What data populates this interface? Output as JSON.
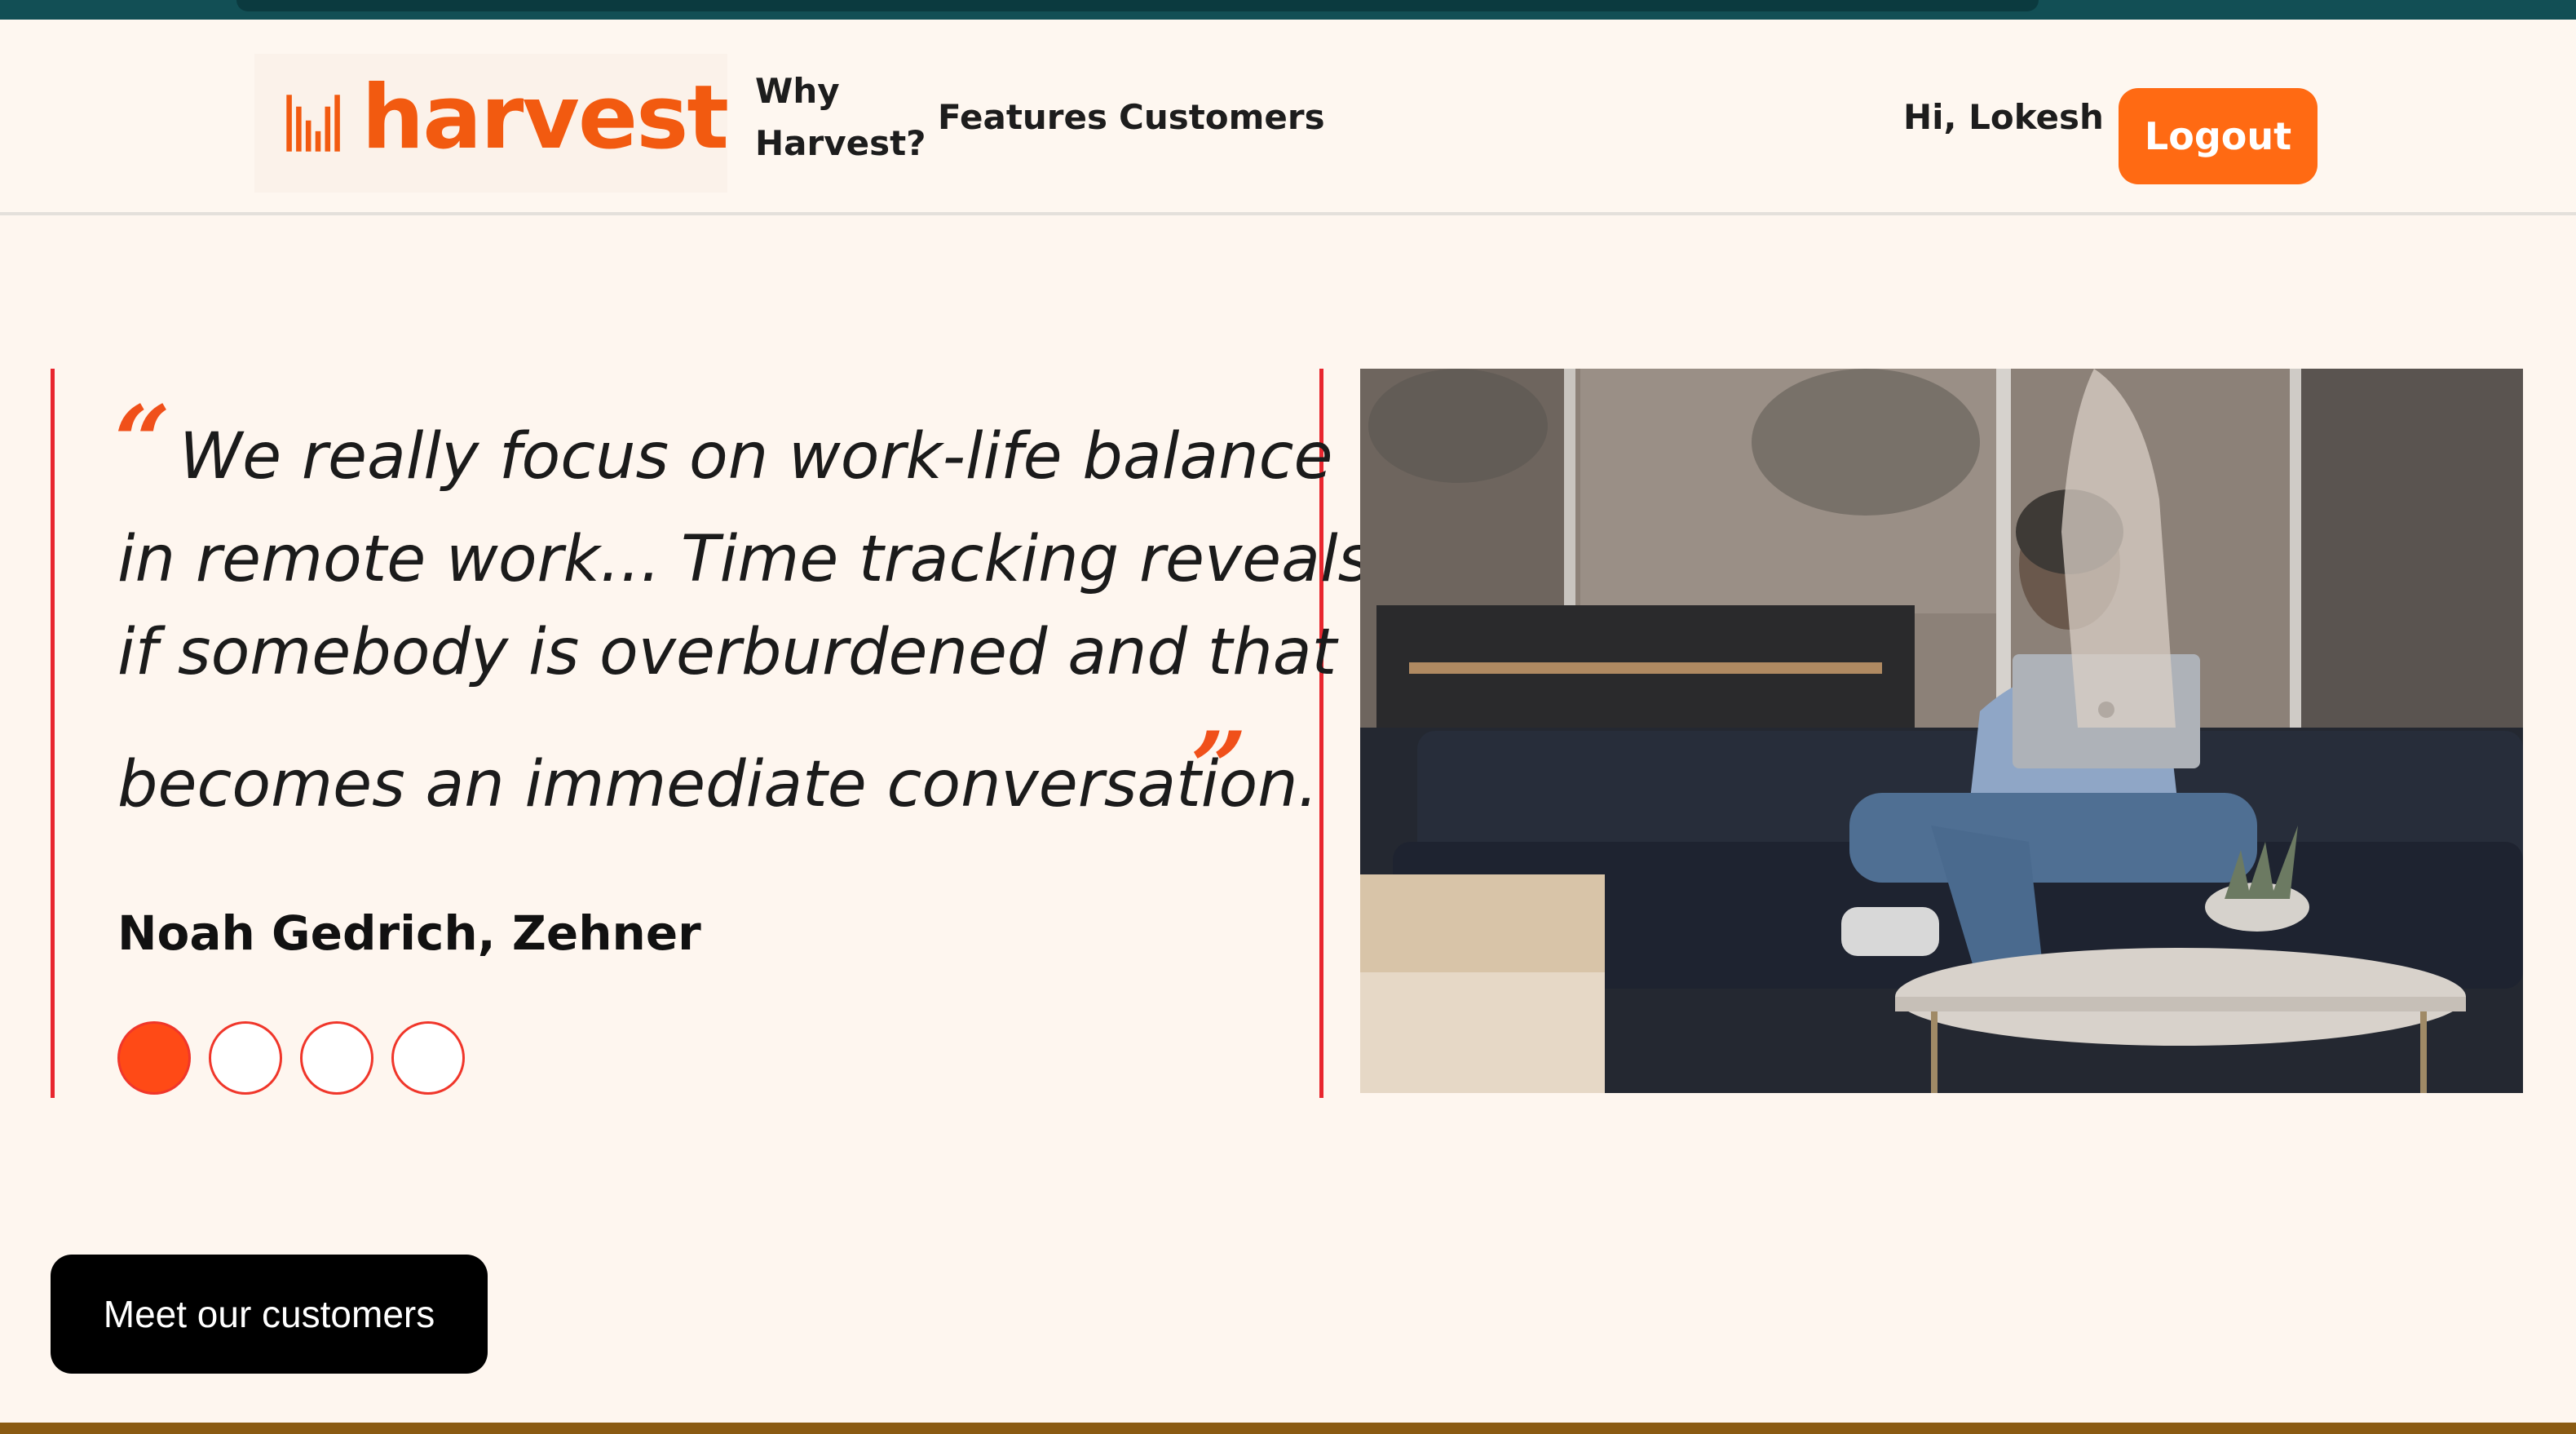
{
  "header": {
    "logo_text": "harvest",
    "nav": [
      {
        "label_line1": "Why",
        "label_line2": "Harvest?"
      },
      {
        "label": "Features"
      },
      {
        "label": "Customers"
      }
    ],
    "greeting": "Hi, Lokesh",
    "logout_label": "Logout"
  },
  "testimonial": {
    "open_quote": "“",
    "close_quote": "”",
    "quote_lines": [
      "We really focus on work-life balance",
      "in remote work... Time tracking reveals",
      "if somebody is overburdened and that",
      "becomes an immediate conversation."
    ],
    "author": "Noah Gedrich, Zehner",
    "pagination": {
      "total": 4,
      "active": 1
    }
  },
  "cta": {
    "label": "Meet our customers"
  },
  "colors": {
    "brand": "#f25a10",
    "logout_bg": "#ff6a13",
    "quote_border": "#e8262e",
    "page_bg": "#fef6ef"
  }
}
